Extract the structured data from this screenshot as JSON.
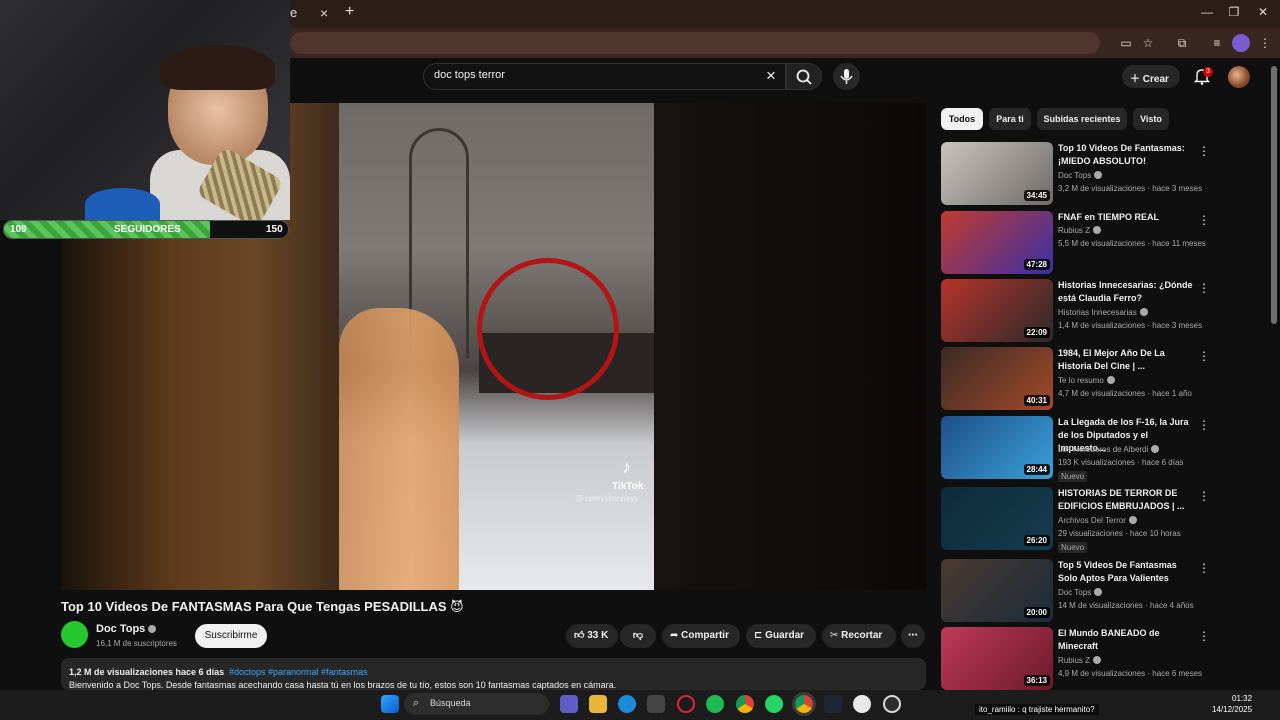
{
  "browser": {
    "tab_close": "e",
    "tab_x": "×",
    "new_tab": "+",
    "minimize": "—",
    "maximize": "❐",
    "close": "✕"
  },
  "header": {
    "search_query": "doc tops terror",
    "create_label": "Crear",
    "notif_count": "3"
  },
  "webcam": {
    "followers_current": "109",
    "followers_label": "SEGUIDORES",
    "followers_goal": "150",
    "progress_fraction": 0.727
  },
  "player": {
    "watermark_brand": "TikTok",
    "watermark_handle": "@ haleyykenneyy"
  },
  "video": {
    "title": "Top 10 Videos De FANTASMAS Para Que Tengas PESADILLAS 😈",
    "channel": "Doc Tops",
    "subscribers": "16,1 M de suscriptores",
    "subscribe_label": "Suscribirme",
    "likes": "33 K",
    "share_label": "Compartir",
    "save_label": "Guardar",
    "clip_label": "Recortar",
    "views_date": "1,2 M de visualizaciones  hace 6 días",
    "tags": "#doctops #paranormal #fantasmas",
    "description": "Bienvenido a Doc Tops. Desde fantasmas acechando casa hasta tú en los brazos de tu tío, estos son 10 fantasmas captados en cámara."
  },
  "sidebar": {
    "chips": [
      "Todos",
      "Para ti",
      "Subidas recientes",
      "Visto"
    ],
    "recommendations": [
      {
        "title": "Top 10 Videos De Fantasmas: ¡MIEDO ABSOLUTO!",
        "channel": "Doc Tops",
        "meta": "3,2 M de visualizaciones · hace 3 meses",
        "duration": "34:45",
        "badge": "",
        "color_a": "#c9c4bd",
        "color_b": "#6e6a66"
      },
      {
        "title": "FNAF en TIEMPO REAL",
        "channel": "Rubius Z",
        "meta": "5,5 M de visualizaciones · hace 11 meses",
        "duration": "47:28",
        "badge": "",
        "color_a": "#c23a2e",
        "color_b": "#3b2fa8"
      },
      {
        "title": "Historias Innecesarias: ¿Dónde está Claudia Ferro?",
        "channel": "Historias Innecesarias",
        "meta": "1,4 M de visualizaciones · hace 3 meses",
        "duration": "22:09",
        "badge": "",
        "color_a": "#b8332a",
        "color_b": "#2a2a2a"
      },
      {
        "title": "1984, El Mejor Año De La Historia Del Cine | ...",
        "channel": "Te lo resumo",
        "meta": "4,7 M de visualizaciones · hace 1 año",
        "duration": "40:31",
        "badge": "",
        "color_a": "#3a2a24",
        "color_b": "#a44a2a"
      },
      {
        "title": "La Llegada de los F-16, la Jura de los Diputados y el Impuesto...",
        "channel": "Los Herederos de Alberdi",
        "meta": "193 K visualizaciones · hace 6 días",
        "duration": "28:44",
        "badge": "Nuevo",
        "color_a": "#1e4f8a",
        "color_b": "#3aa0d8"
      },
      {
        "title": "HISTORIAS DE TERROR DE EDIFICIOS EMBRUJADOS | ...",
        "channel": "Archivos Del Terror",
        "meta": "29 visualizaciones · hace 10 horas",
        "duration": "26:20",
        "badge": "Nuevo",
        "color_a": "#0d2a3a",
        "color_b": "#163c4e"
      },
      {
        "title": "Top 5 Videos De Fantasmas Solo Aptos Para Valientes",
        "channel": "Doc Tops",
        "meta": "14 M de visualizaciones · hace 4 años",
        "duration": "20:00",
        "badge": "",
        "color_a": "#4a3a30",
        "color_b": "#1b2b3a"
      },
      {
        "title": "El Mundo BANEADO de Minecraft",
        "channel": "Rubius Z",
        "meta": "4,9 M de visualizaciones · hace 6 meses",
        "duration": "36:13",
        "badge": "",
        "color_a": "#c0395a",
        "color_b": "#6a1a2a"
      }
    ]
  },
  "taskbar": {
    "search_label": "Búsqueda",
    "chat_text": "ito_ramiilo : q trajiste hermanito?",
    "time": "01:32",
    "date": "14/12/2025"
  }
}
